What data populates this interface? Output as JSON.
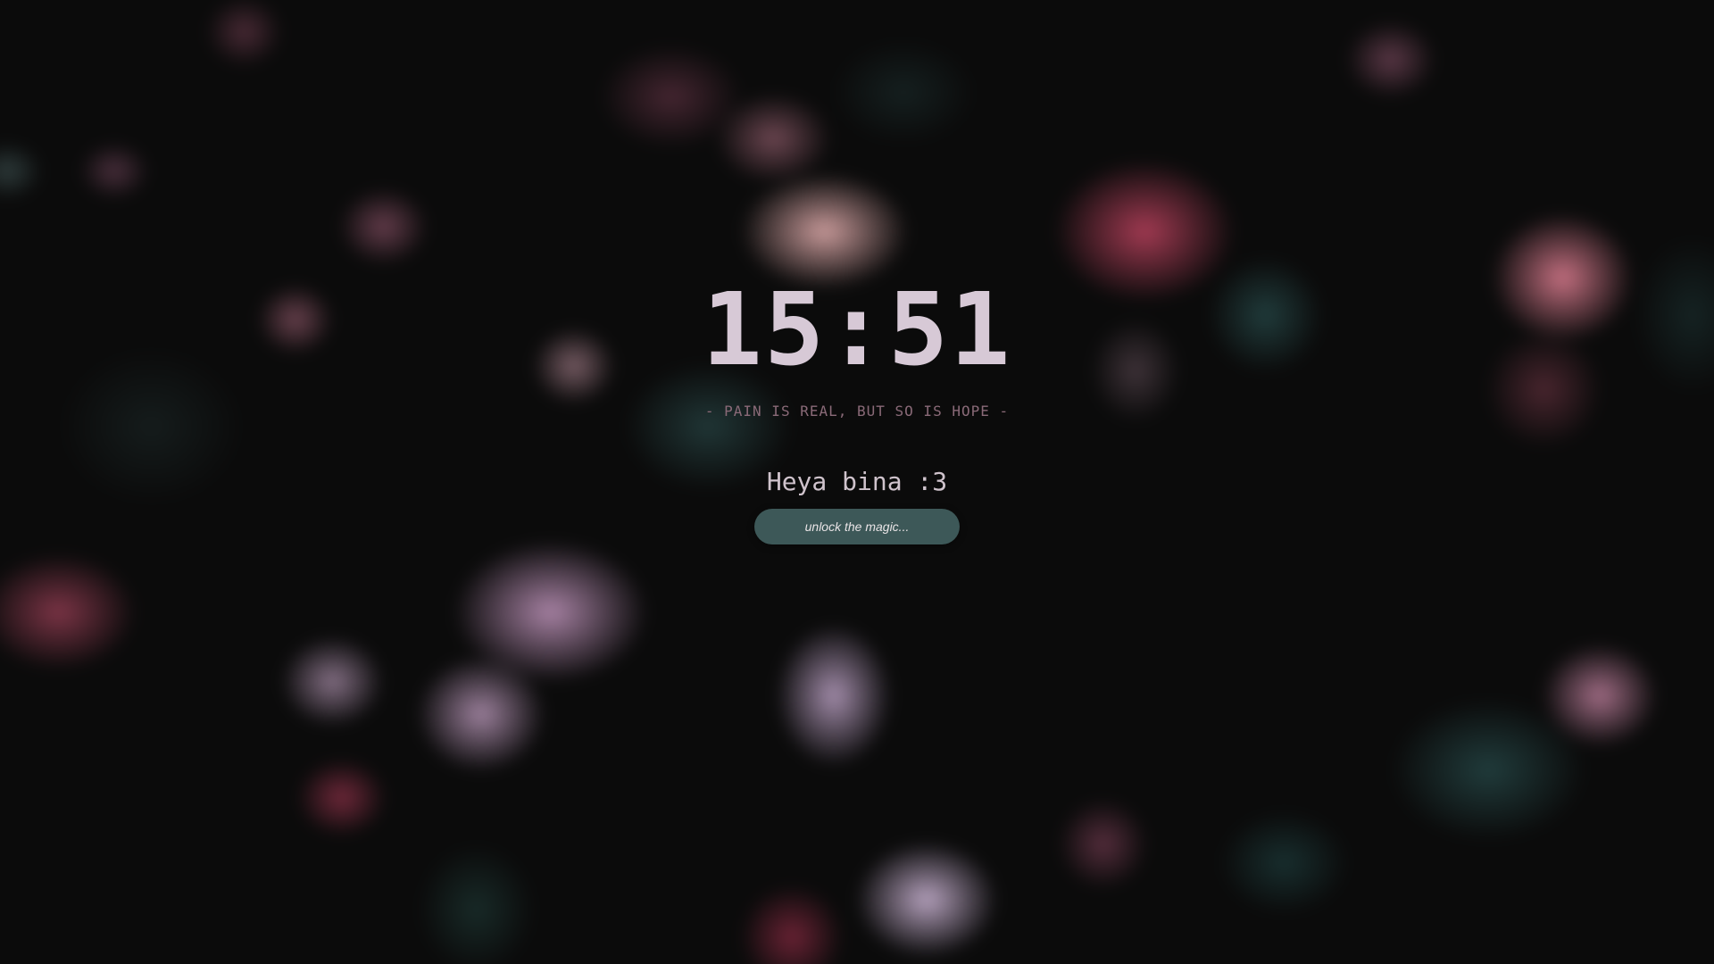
{
  "lockscreen": {
    "clock": "15:51",
    "tagline": "- PAIN IS REAL, BUT SO IS HOPE -",
    "greeting": "Heya bina :3",
    "unlock_label": "unlock the magic..."
  },
  "colors": {
    "clock_text": "#d7c9d6",
    "tagline_text": "#8a6a78",
    "greeting_text": "#cfc3cc",
    "unlock_button_bg": "#3d5858",
    "background": "#0b0b0b"
  }
}
